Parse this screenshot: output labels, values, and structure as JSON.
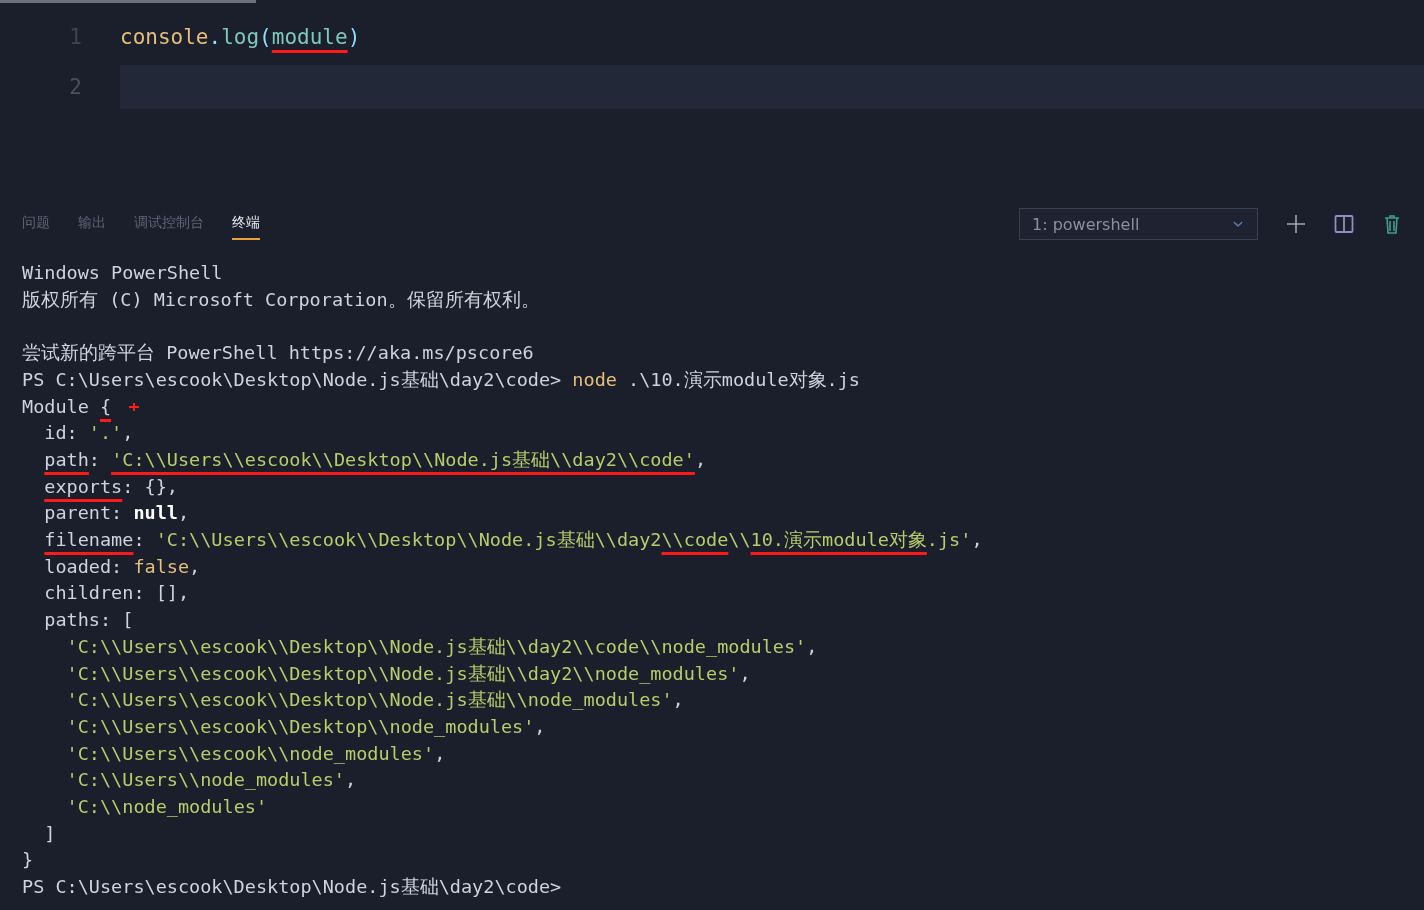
{
  "editor": {
    "lines": [
      {
        "number": "1",
        "current": false,
        "segments": [
          {
            "text": "console",
            "kind": "object"
          },
          {
            "text": ".",
            "kind": "punct"
          },
          {
            "text": "log",
            "kind": "method"
          },
          {
            "text": "(",
            "kind": "punct"
          },
          {
            "text": "module",
            "kind": "marked_ident"
          },
          {
            "text": ")",
            "kind": "punct"
          }
        ]
      },
      {
        "number": "2",
        "current": true
      }
    ]
  },
  "panel": {
    "tabs": [
      {
        "label": "问题",
        "selected": false
      },
      {
        "label": "输出",
        "selected": false
      },
      {
        "label": "调试控制台",
        "selected": false
      },
      {
        "label": "终端",
        "selected": true
      }
    ],
    "terminal_select": {
      "value": "1: powershell"
    }
  },
  "terminal": {
    "blocks": [
      [
        {
          "kind": "output",
          "segments": [
            {
              "text": "Windows PowerShell",
              "kind": "plain"
            }
          ]
        },
        {
          "kind": "output",
          "segments": [
            {
              "text": "版权所有 (C) Microsoft Corporation。保留所有权利。",
              "kind": "plain"
            }
          ]
        }
      ],
      [
        {
          "kind": "output",
          "segments": [
            {
              "text": "尝试新的跨平台 PowerShell https://aka.ms/pscore6",
              "kind": "plain"
            }
          ]
        },
        {
          "kind": "output",
          "segments": [
            {
              "text": "PS C:\\Users\\escook\\Desktop\\Node.js基础\\day2\\code> ",
              "kind": "plain"
            },
            {
              "text": "node",
              "kind": "command"
            },
            {
              "text": " .\\10.演示module对象.js",
              "kind": "plain"
            }
          ]
        },
        {
          "kind": "annotated",
          "segments": [
            {
              "text": "Module ",
              "kind": "plain"
            },
            {
              "text": "{",
              "kind": "marked"
            }
          ]
        },
        {
          "kind": "output",
          "segments": [
            {
              "text": "  id: ",
              "kind": "plain"
            },
            {
              "text": "'.'",
              "kind": "string"
            },
            {
              "text": ",",
              "kind": "plain"
            }
          ]
        },
        {
          "kind": "output",
          "segments": [
            {
              "text": "  path",
              "kind": "marked"
            },
            {
              "text": ": ",
              "kind": "plain"
            },
            {
              "text": "'C:\\\\Users\\\\escook\\\\Desktop\\\\Node.js基础\\\\day2\\\\code'",
              "kind": "marked_string"
            },
            {
              "text": ",",
              "kind": "plain"
            }
          ]
        },
        {
          "kind": "output",
          "segments": [
            {
              "text": "  exports",
              "kind": "marked"
            },
            {
              "text": ": {},",
              "kind": "plain"
            }
          ]
        },
        {
          "kind": "output",
          "segments": [
            {
              "text": "  parent: ",
              "kind": "plain"
            },
            {
              "text": "null",
              "kind": "null"
            },
            {
              "text": ",",
              "kind": "plain"
            }
          ]
        },
        {
          "kind": "output",
          "segments": [
            {
              "text": "  filename",
              "kind": "marked"
            },
            {
              "text": ": ",
              "kind": "plain"
            },
            {
              "text": "'C:\\\\Users\\\\escook\\\\Desktop\\\\Node.js基础\\\\day2",
              "kind": "string"
            },
            {
              "text": "\\\\code",
              "kind": "marked_string"
            },
            {
              "text": "\\\\",
              "kind": "string"
            },
            {
              "text": "10.演示module对象",
              "kind": "marked_string"
            },
            {
              "text": ".js'",
              "kind": "string"
            },
            {
              "text": ",",
              "kind": "plain"
            }
          ]
        },
        {
          "kind": "output",
          "segments": [
            {
              "text": "  loaded: ",
              "kind": "plain"
            },
            {
              "text": "false",
              "kind": "keyword"
            },
            {
              "text": ",",
              "kind": "plain"
            }
          ]
        },
        {
          "kind": "output",
          "segments": [
            {
              "text": "  children: [],",
              "kind": "plain"
            }
          ]
        },
        {
          "kind": "output",
          "segments": [
            {
              "text": "  paths: [",
              "kind": "plain"
            }
          ]
        },
        {
          "kind": "output",
          "segments": [
            {
              "text": "    'C:\\\\Users\\\\escook\\\\Desktop\\\\Node.js基础\\\\day2\\\\code\\\\node_modules'",
              "kind": "string"
            },
            {
              "text": ",",
              "kind": "plain"
            }
          ]
        },
        {
          "kind": "output",
          "segments": [
            {
              "text": "    'C:\\\\Users\\\\escook\\\\Desktop\\\\Node.js基础\\\\day2\\\\node_modules'",
              "kind": "string"
            },
            {
              "text": ",",
              "kind": "plain"
            }
          ]
        },
        {
          "kind": "output",
          "segments": [
            {
              "text": "    'C:\\\\Users\\\\escook\\\\Desktop\\\\Node.js基础\\\\node_modules'",
              "kind": "string"
            },
            {
              "text": ",",
              "kind": "plain"
            }
          ]
        },
        {
          "kind": "output",
          "segments": [
            {
              "text": "    'C:\\\\Users\\\\escook\\\\Desktop\\\\node_modules'",
              "kind": "string"
            },
            {
              "text": ",",
              "kind": "plain"
            }
          ]
        },
        {
          "kind": "output",
          "segments": [
            {
              "text": "    'C:\\\\Users\\\\escook\\\\node_modules'",
              "kind": "string"
            },
            {
              "text": ",",
              "kind": "plain"
            }
          ]
        },
        {
          "kind": "output",
          "segments": [
            {
              "text": "    'C:\\\\Users\\\\node_modules'",
              "kind": "string"
            },
            {
              "text": ",",
              "kind": "plain"
            }
          ]
        },
        {
          "kind": "output",
          "segments": [
            {
              "text": "    'C:\\\\node_modules'",
              "kind": "string"
            }
          ]
        },
        {
          "kind": "output",
          "segments": [
            {
              "text": "  ]",
              "kind": "plain"
            }
          ]
        },
        {
          "kind": "output",
          "segments": [
            {
              "text": "}",
              "kind": "plain"
            }
          ]
        },
        {
          "kind": "output",
          "segments": [
            {
              "text": "PS C:\\Users\\escook\\Desktop\\Node.js基础\\day2\\code>",
              "kind": "plain"
            }
          ]
        }
      ]
    ]
  }
}
